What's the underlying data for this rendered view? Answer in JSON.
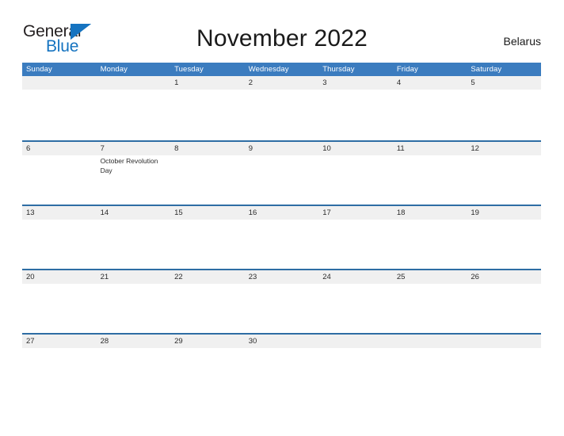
{
  "brand": {
    "name_part1": "General",
    "name_part2": "Blue",
    "flag_icon": "blue-triangle-flag-icon",
    "color_dark": "#231f20",
    "color_blue": "#1573c0"
  },
  "header": {
    "title": "November 2022",
    "country": "Belarus"
  },
  "calendar": {
    "accent_header_color": "#3b7cbf",
    "row_border_color": "#2e6da4",
    "daynum_band_color": "#f0f0f0",
    "weekdays": [
      "Sunday",
      "Monday",
      "Tuesday",
      "Wednesday",
      "Thursday",
      "Friday",
      "Saturday"
    ],
    "weeks": [
      [
        {
          "day": "",
          "events": []
        },
        {
          "day": "",
          "events": []
        },
        {
          "day": "1",
          "events": []
        },
        {
          "day": "2",
          "events": []
        },
        {
          "day": "3",
          "events": []
        },
        {
          "day": "4",
          "events": []
        },
        {
          "day": "5",
          "events": []
        }
      ],
      [
        {
          "day": "6",
          "events": []
        },
        {
          "day": "7",
          "events": [
            "October Revolution Day"
          ]
        },
        {
          "day": "8",
          "events": []
        },
        {
          "day": "9",
          "events": []
        },
        {
          "day": "10",
          "events": []
        },
        {
          "day": "11",
          "events": []
        },
        {
          "day": "12",
          "events": []
        }
      ],
      [
        {
          "day": "13",
          "events": []
        },
        {
          "day": "14",
          "events": []
        },
        {
          "day": "15",
          "events": []
        },
        {
          "day": "16",
          "events": []
        },
        {
          "day": "17",
          "events": []
        },
        {
          "day": "18",
          "events": []
        },
        {
          "day": "19",
          "events": []
        }
      ],
      [
        {
          "day": "20",
          "events": []
        },
        {
          "day": "21",
          "events": []
        },
        {
          "day": "22",
          "events": []
        },
        {
          "day": "23",
          "events": []
        },
        {
          "day": "24",
          "events": []
        },
        {
          "day": "25",
          "events": []
        },
        {
          "day": "26",
          "events": []
        }
      ],
      [
        {
          "day": "27",
          "events": []
        },
        {
          "day": "28",
          "events": []
        },
        {
          "day": "29",
          "events": []
        },
        {
          "day": "30",
          "events": []
        },
        {
          "day": "",
          "events": []
        },
        {
          "day": "",
          "events": []
        },
        {
          "day": "",
          "events": []
        }
      ]
    ]
  }
}
